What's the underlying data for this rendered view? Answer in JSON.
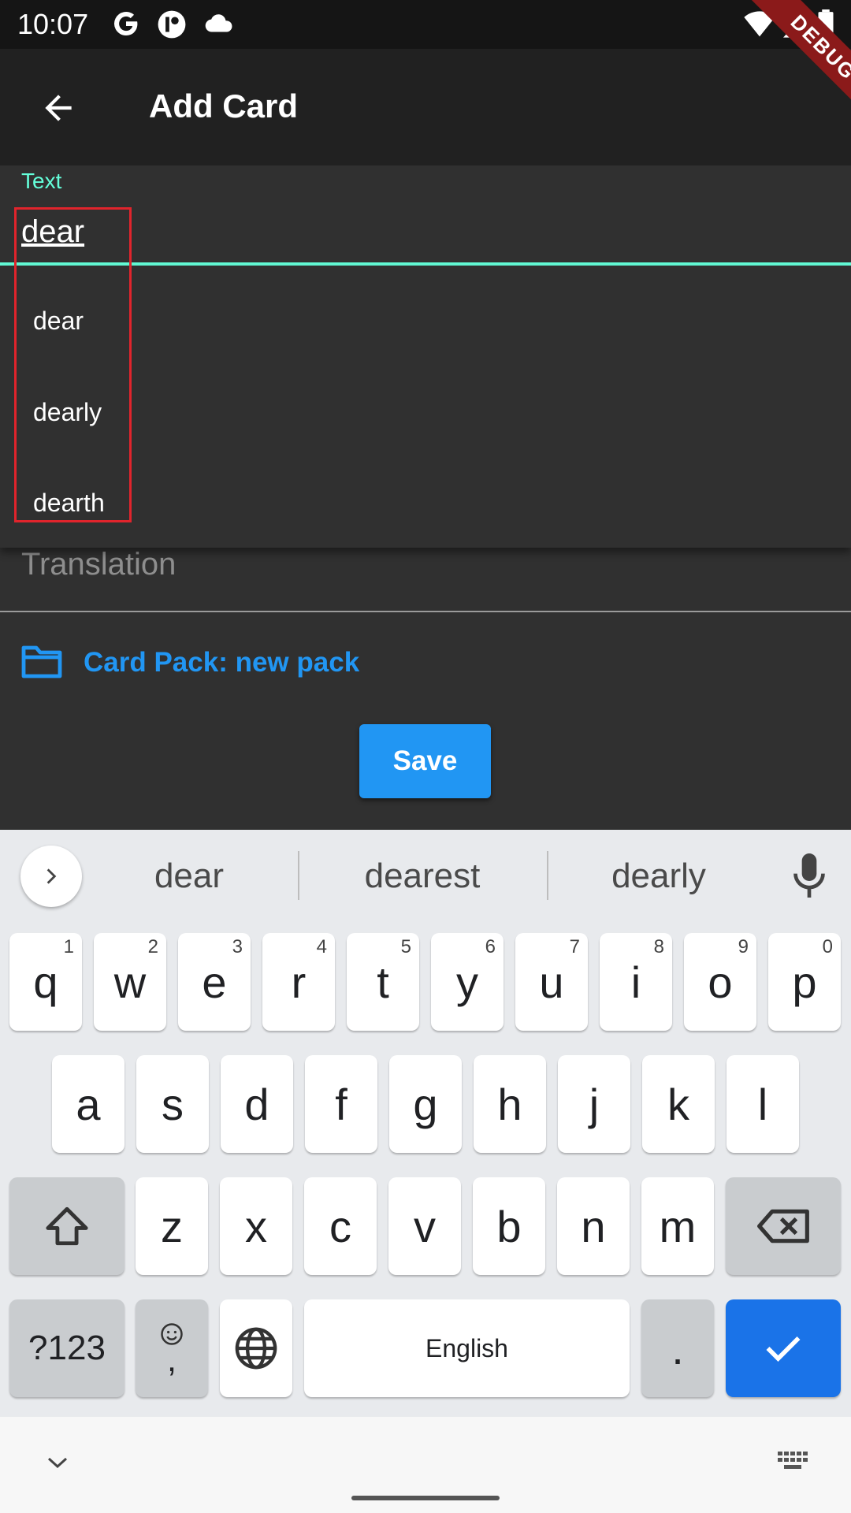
{
  "status_bar": {
    "time": "10:07",
    "icons": [
      "google-icon",
      "app-icon",
      "cloud-icon",
      "wifi-icon",
      "signal-icon",
      "battery-icon"
    ]
  },
  "debug_banner": "DEBUG",
  "app_bar": {
    "title": "Add Card"
  },
  "form": {
    "text_label": "Text",
    "text_value": "dear",
    "suggestions": [
      "dear",
      "dearly",
      "dearth"
    ],
    "translation_placeholder": "Translation",
    "card_pack": "Card Pack: new pack",
    "save_label": "Save"
  },
  "keyboard": {
    "suggestions": [
      "dear",
      "dearest",
      "dearly"
    ],
    "row1": [
      {
        "k": "q",
        "n": "1"
      },
      {
        "k": "w",
        "n": "2"
      },
      {
        "k": "e",
        "n": "3"
      },
      {
        "k": "r",
        "n": "4"
      },
      {
        "k": "t",
        "n": "5"
      },
      {
        "k": "y",
        "n": "6"
      },
      {
        "k": "u",
        "n": "7"
      },
      {
        "k": "i",
        "n": "8"
      },
      {
        "k": "o",
        "n": "9"
      },
      {
        "k": "p",
        "n": "0"
      }
    ],
    "row2": [
      "a",
      "s",
      "d",
      "f",
      "g",
      "h",
      "j",
      "k",
      "l"
    ],
    "row3": [
      "z",
      "x",
      "c",
      "v",
      "b",
      "n",
      "m"
    ],
    "symbols_label": "?123",
    "emoji_comma": ",",
    "space_label": "English",
    "period": "."
  },
  "colors": {
    "accent": "#64ffda",
    "primary": "#2196f3",
    "keyboard_action": "#1a73e8"
  }
}
